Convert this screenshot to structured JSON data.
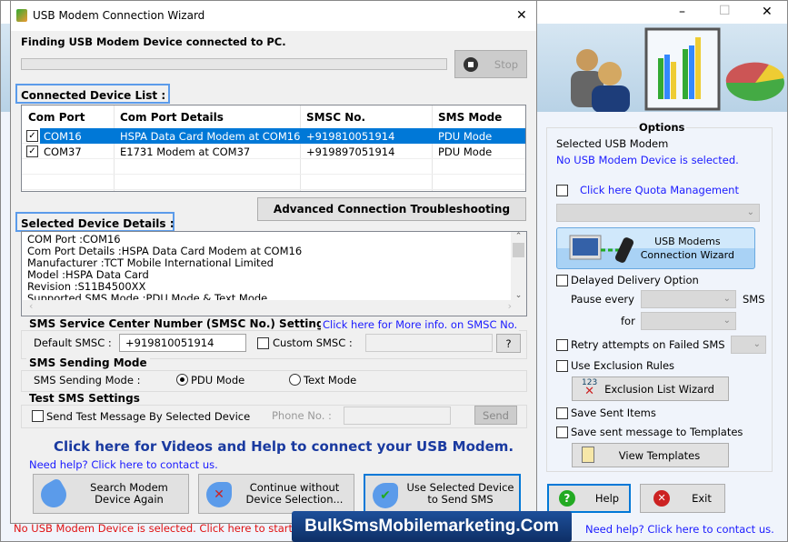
{
  "main_window": {
    "controls": {
      "minimize": "–",
      "maximize": "☐",
      "close": "✕"
    },
    "options": {
      "title": "Options",
      "selected_label": "Selected USB Modem",
      "selected_value": "No USB Modem Device is selected.",
      "quota_link": "Click here Quota Management",
      "wizard_button_line1": "USB Modems",
      "wizard_button_line2": "Connection  Wizard",
      "delayed_delivery": "Delayed Delivery Option",
      "pause_every": "Pause every",
      "sms": "SMS",
      "for": "for",
      "retry": "Retry attempts on Failed SMS",
      "exclusion_rules": "Use Exclusion Rules",
      "exclusion_wizard": "Exclusion List Wizard",
      "exclusion_icon_text": "123",
      "save_sent": "Save Sent Items",
      "save_templates": "Save sent message to Templates",
      "view_templates": "View Templates"
    },
    "help_button": "Help",
    "exit_button": "Exit",
    "need_help": "Need help? Click here to contact us."
  },
  "dialog": {
    "title": "USB Modem Connection Wizard",
    "close": "✕",
    "finding_text": "Finding USB Modem Device connected to PC.",
    "progress": 0,
    "stop_button": "Stop",
    "connected_list_label": "Connected Device List :",
    "table": {
      "headers": [
        "Com Port",
        "Com Port Details",
        "SMSC No.",
        "SMS Mode"
      ],
      "rows": [
        {
          "checked": true,
          "port": "COM16",
          "details": "HSPA Data Card Modem at COM16",
          "smsc": "+919810051914",
          "mode": "PDU Mode",
          "selected": true
        },
        {
          "checked": true,
          "port": "COM37",
          "details": "E1731 Modem at COM37",
          "smsc": "+919897051914",
          "mode": "PDU Mode",
          "selected": false
        }
      ]
    },
    "advanced_button": "Advanced Connection Troubleshooting",
    "selected_details_label": "Selected Device Details :",
    "details_lines": [
      "COM Port :COM16",
      "Com Port Details :HSPA Data Card Modem at COM16",
      "Manufacturer :TCT Mobile International Limited",
      "Model :HSPA Data Card",
      "Revision :S11B4500XX",
      "Supported SMS Mode :PDU Mode & Text Mode"
    ],
    "smsc": {
      "title": "SMS Service Center Number (SMSC No.) Settings",
      "info_link": "Click here for More info. on SMSC No.",
      "default_label": "Default SMSC :",
      "default_value": "+919810051914",
      "custom_label": "Custom SMSC :",
      "custom_value": "",
      "help_button": "?"
    },
    "sending_mode": {
      "title": "SMS Sending Mode",
      "label": "SMS Sending Mode :",
      "pdu": "PDU Mode",
      "text": "Text Mode",
      "selected": "PDU Mode"
    },
    "test": {
      "title": "Test SMS Settings",
      "checkbox": "Send Test Message By Selected Device",
      "phone_label": "Phone No. :",
      "phone_value": "",
      "send_button": "Send"
    },
    "video_help": "Click here for Videos and Help to connect your USB Modem.",
    "need_help": "Need help? Click here to contact us.",
    "buttons": {
      "search_l1": "Search Modem",
      "search_l2": "Device Again",
      "continue_l1": "Continue without",
      "continue_l2": "Device Selection...",
      "use_l1": "Use Selected Device",
      "use_l2": "to Send SMS"
    }
  },
  "status_text": "No USB Modem Device is selected. Click here to start",
  "watermark": "BulkSmsMobilemarketing.Com"
}
